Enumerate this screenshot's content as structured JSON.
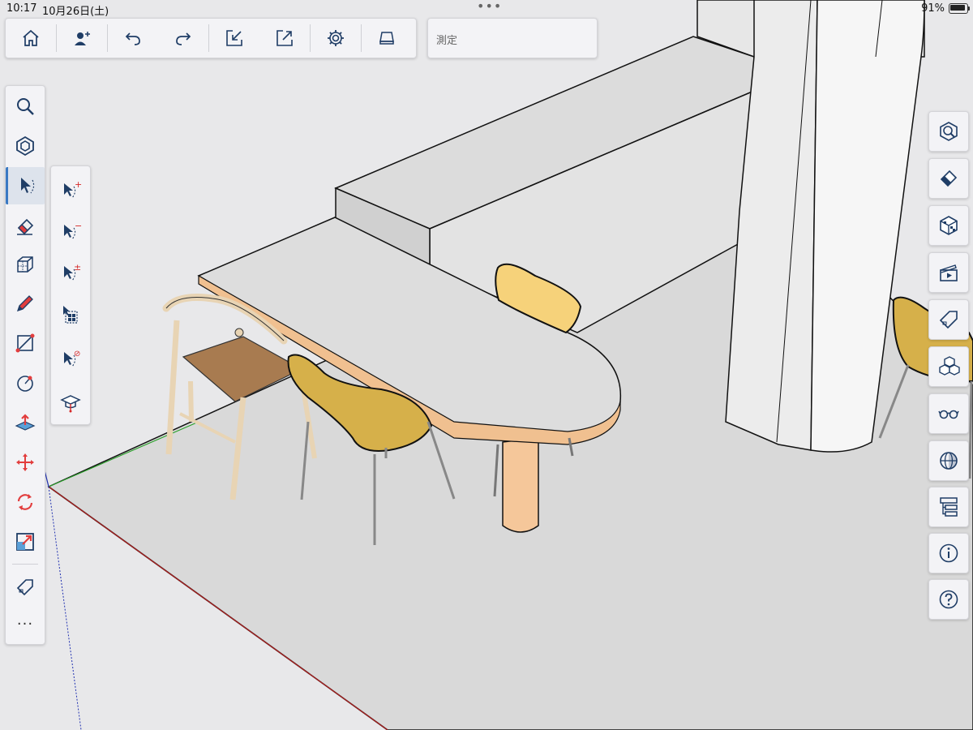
{
  "status_bar": {
    "time": "10:17",
    "date": "10月26日(土)",
    "battery": "91%"
  },
  "top_toolbar": {
    "buttons": [
      {
        "name": "home",
        "icon": "home-icon"
      },
      {
        "name": "profile",
        "icon": "user-add-icon"
      },
      {
        "name": "undo",
        "icon": "undo-icon"
      },
      {
        "name": "redo",
        "icon": "redo-icon"
      },
      {
        "name": "import",
        "icon": "import-icon"
      },
      {
        "name": "export",
        "icon": "export-icon"
      },
      {
        "name": "settings",
        "icon": "gear-icon"
      },
      {
        "name": "display",
        "icon": "display-icon"
      }
    ]
  },
  "measure_box": {
    "label": "測定"
  },
  "left_toolbar": {
    "tools": [
      {
        "name": "search",
        "icon": "search-icon"
      },
      {
        "name": "component",
        "icon": "component-icon"
      },
      {
        "name": "select",
        "icon": "select-icon",
        "active": true
      },
      {
        "name": "eraser",
        "icon": "eraser-icon"
      },
      {
        "name": "box",
        "icon": "box-icon"
      },
      {
        "name": "pencil",
        "icon": "pencil-icon"
      },
      {
        "name": "line",
        "icon": "line-icon"
      },
      {
        "name": "circle",
        "icon": "circle-icon"
      },
      {
        "name": "push-pull",
        "icon": "push-pull-icon"
      },
      {
        "name": "move",
        "icon": "move-icon"
      },
      {
        "name": "rotate",
        "icon": "rotate-icon"
      },
      {
        "name": "scale",
        "icon": "scale-icon"
      },
      {
        "name": "tag",
        "icon": "tag-icon"
      }
    ],
    "more_label": "···"
  },
  "select_subtools": [
    {
      "name": "select-add",
      "icon": "select-add-icon",
      "sign": "+"
    },
    {
      "name": "select-remove",
      "icon": "select-remove-icon",
      "sign": "−"
    },
    {
      "name": "select-toggle",
      "icon": "select-toggle-icon",
      "sign": "±"
    },
    {
      "name": "select-all",
      "icon": "select-all-icon"
    },
    {
      "name": "select-none",
      "icon": "select-none-icon",
      "sign": "⊘"
    },
    {
      "name": "learn",
      "icon": "graduation-cap-icon"
    }
  ],
  "right_toolbar": {
    "panels": [
      {
        "name": "view",
        "icon": "view-icon"
      },
      {
        "name": "eraser",
        "icon": "eraser-icon"
      },
      {
        "name": "materials",
        "icon": "materials-icon"
      },
      {
        "name": "scenes",
        "icon": "scenes-icon"
      },
      {
        "name": "tags",
        "icon": "tag-icon"
      },
      {
        "name": "components",
        "icon": "components-icon"
      },
      {
        "name": "display-styles",
        "icon": "glasses-icon"
      },
      {
        "name": "xray",
        "icon": "xray-icon"
      },
      {
        "name": "outliner",
        "icon": "outliner-icon"
      },
      {
        "name": "info",
        "icon": "info-icon"
      },
      {
        "name": "help",
        "icon": "help-icon"
      }
    ]
  },
  "colors": {
    "accent": "#3a79c3",
    "icon": "#1f3d66",
    "tool_red": "#d62a2a",
    "axis_green": "#2aa02a",
    "axis_red": "#b02020",
    "axis_blue": "#2030b0"
  }
}
